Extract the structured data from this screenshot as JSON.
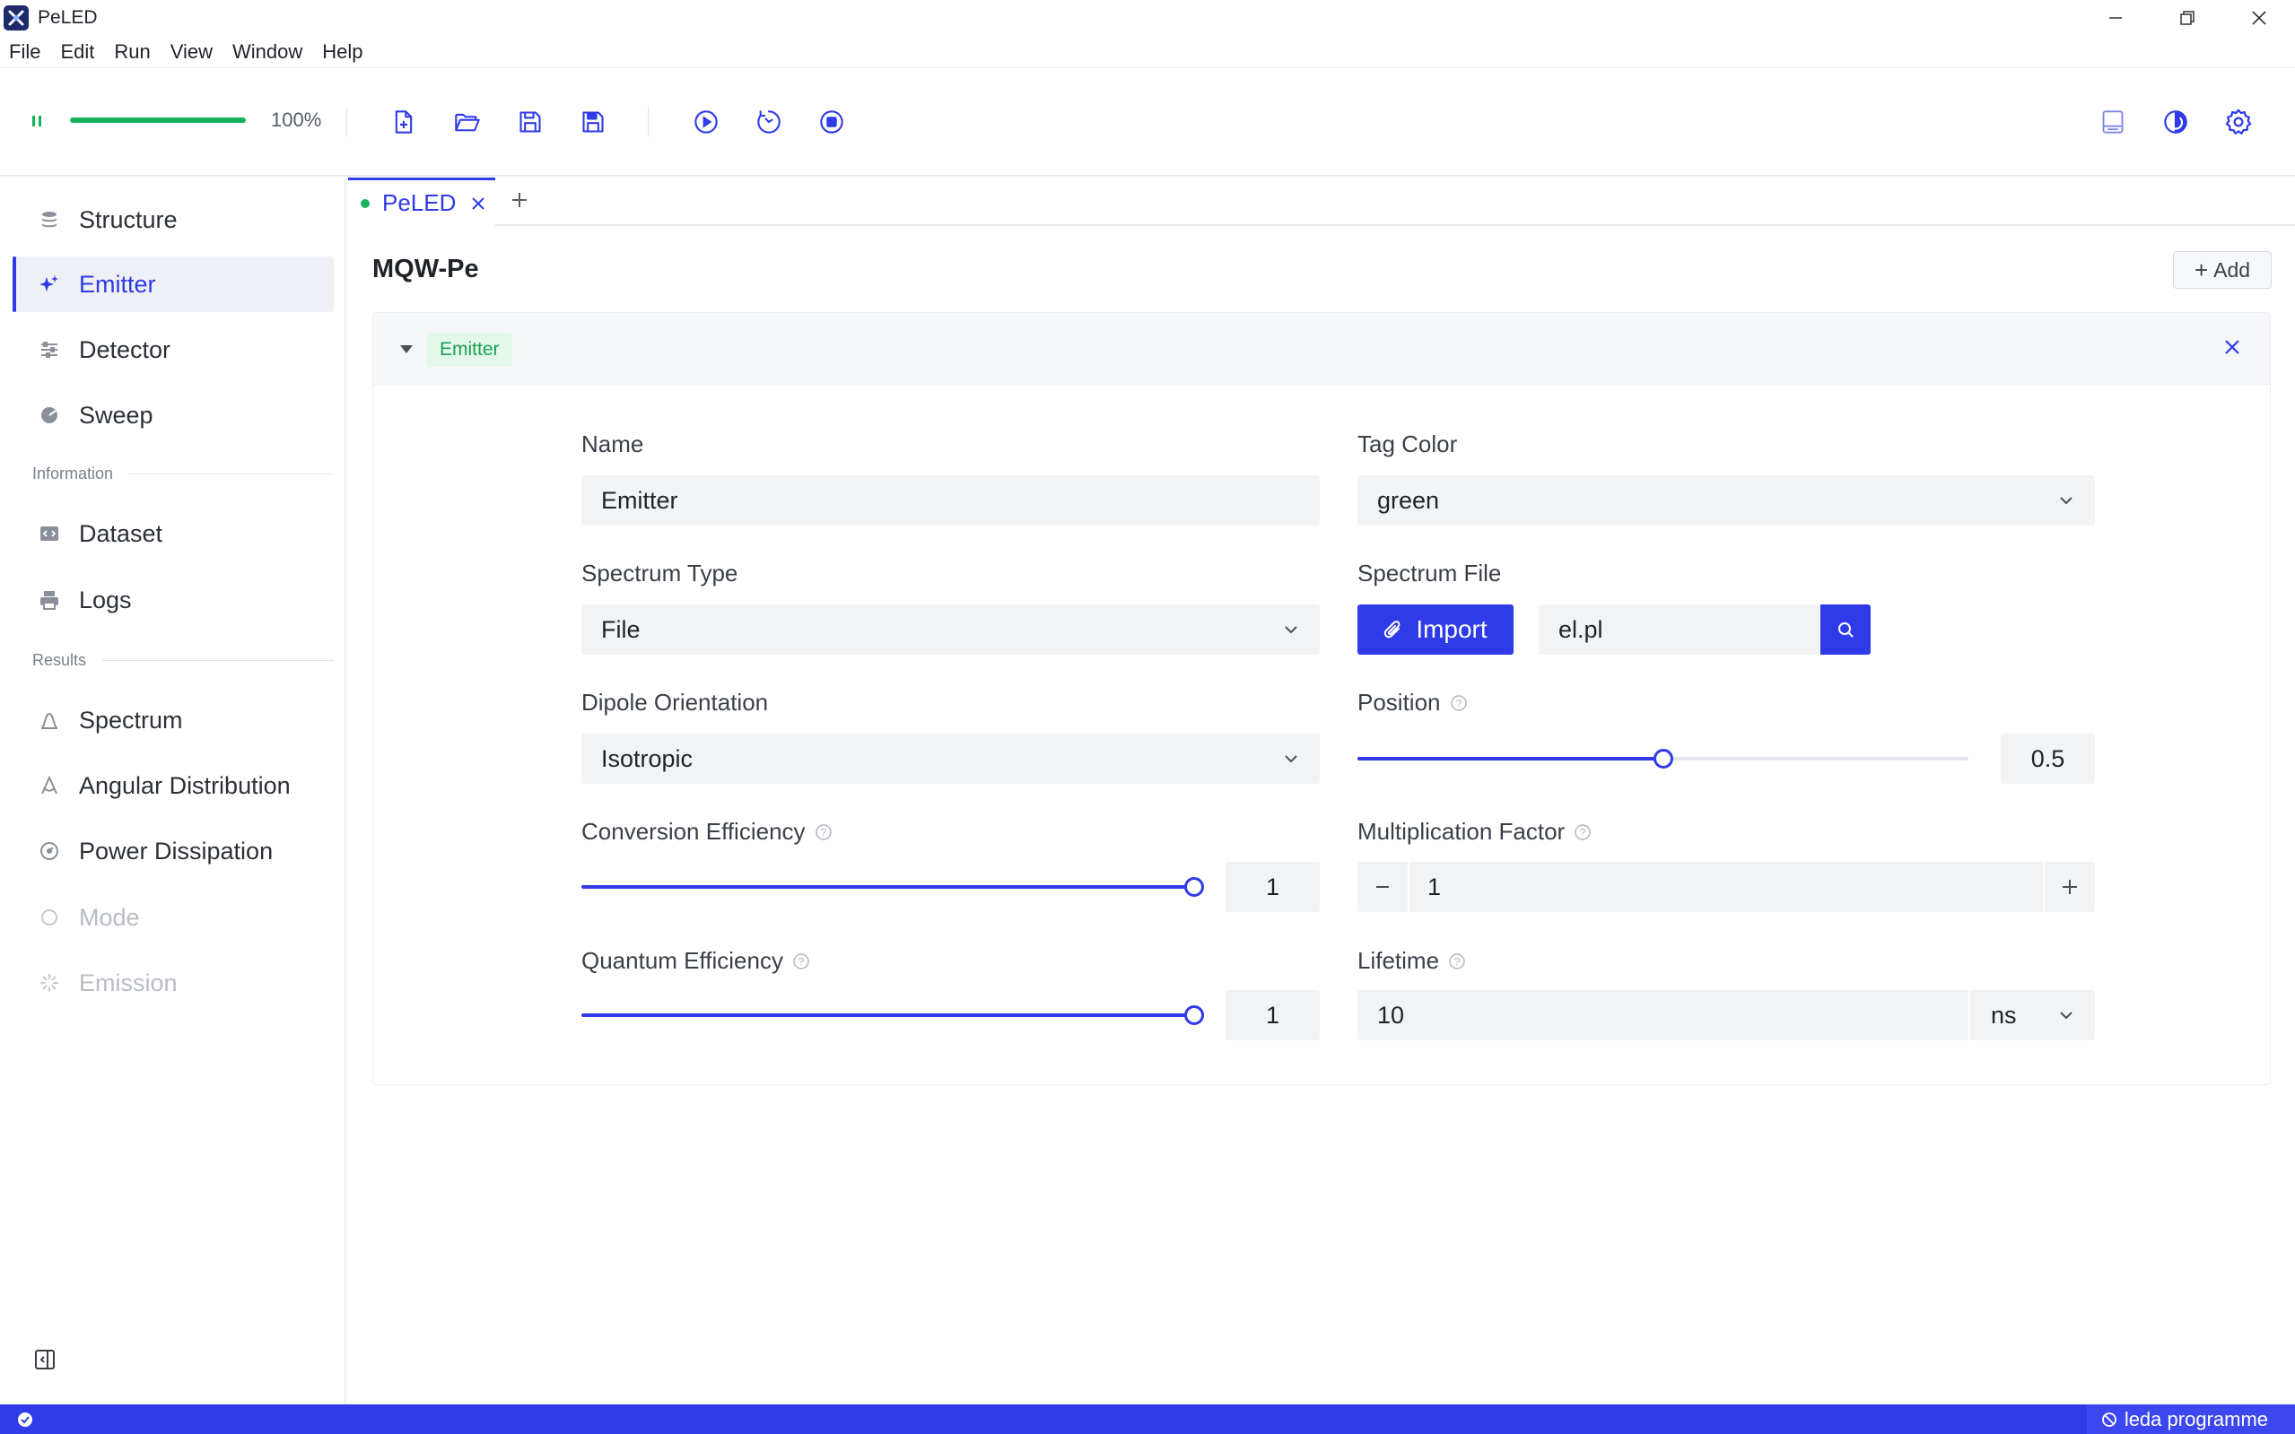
{
  "window": {
    "title": "PeLED"
  },
  "menu": [
    "File",
    "Edit",
    "Run",
    "View",
    "Window",
    "Help"
  ],
  "toolbar": {
    "progress_percent": 100,
    "progress_label": "100%",
    "icons": [
      "new-file-icon",
      "open-folder-icon",
      "save-icon",
      "save-as-icon",
      "run-icon",
      "timer-run-icon",
      "stop-icon",
      "layout-icon",
      "theme-icon",
      "settings-icon"
    ]
  },
  "sidebar": {
    "items": [
      {
        "label": "Structure",
        "icon": "layers-icon",
        "active": false
      },
      {
        "label": "Emitter",
        "icon": "sparkle-icon",
        "active": true
      },
      {
        "label": "Detector",
        "icon": "sliders-icon",
        "active": false
      },
      {
        "label": "Sweep",
        "icon": "sweep-icon",
        "active": false
      }
    ],
    "group_information": "Information",
    "info_items": [
      {
        "label": "Dataset",
        "icon": "code-icon"
      },
      {
        "label": "Logs",
        "icon": "printer-icon"
      }
    ],
    "group_results": "Results",
    "result_items": [
      {
        "label": "Spectrum",
        "icon": "spectrum-icon",
        "disabled": false
      },
      {
        "label": "Angular Distribution",
        "icon": "angle-icon",
        "disabled": false
      },
      {
        "label": "Power Dissipation",
        "icon": "gauge-icon",
        "disabled": false
      },
      {
        "label": "Mode",
        "icon": "circle-icon",
        "disabled": true
      },
      {
        "label": "Emission",
        "icon": "loader-icon",
        "disabled": true
      }
    ]
  },
  "tabs": [
    {
      "label": "PeLED",
      "active": true
    }
  ],
  "main": {
    "title": "MQW-Pe",
    "add_label": "Add",
    "panel": {
      "tag": "Emitter",
      "tag_color": "#1aa155",
      "fields": {
        "name_label": "Name",
        "name_value": "Emitter",
        "tag_color_label": "Tag Color",
        "tag_color_value": "green",
        "spectrum_type_label": "Spectrum Type",
        "spectrum_type_value": "File",
        "spectrum_file_label": "Spectrum File",
        "import_label": "Import",
        "spectrum_file_value": "el.pl",
        "dipole_label": "Dipole Orientation",
        "dipole_value": "Isotropic",
        "position_label": "Position",
        "position_value": "0.5",
        "conversion_label": "Conversion Efficiency",
        "conversion_value": "1",
        "multiplication_label": "Multiplication Factor",
        "multiplication_value": "1",
        "quantum_label": "Quantum Efficiency",
        "quantum_value": "1",
        "lifetime_label": "Lifetime",
        "lifetime_value": "10",
        "lifetime_unit": "ns"
      },
      "sliders": {
        "position": 0.5,
        "conversion": 1,
        "quantum": 1
      }
    }
  },
  "statusbar": {
    "right_label": "leda programme"
  },
  "colors": {
    "accent": "#2f3ae8",
    "success": "#17b35a",
    "tag_bg": "#e3f7ea"
  }
}
